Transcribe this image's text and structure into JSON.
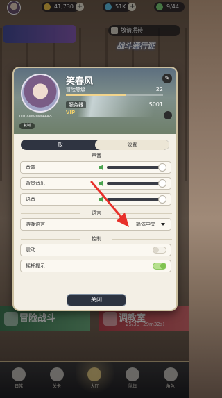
{
  "topbar": {
    "currency1": "41,730",
    "currency2": "51K",
    "stamina": "9/44",
    "colors": {
      "coin": "#f1c44a",
      "gem": "#62c3e8",
      "energy": "#7fd47a"
    }
  },
  "background": {
    "notice_label": "敬请期待",
    "battle_pass_label": "战斗通行证",
    "adventure_label": "冒险战斗",
    "training_label": "调教室",
    "training_sub": "25/30 (29m32s)",
    "nav": [
      {
        "label": "日常",
        "icon": "calendar-icon"
      },
      {
        "label": "关卡",
        "icon": "book-icon"
      },
      {
        "label": "大厅",
        "icon": "hall-icon",
        "active": true
      },
      {
        "label": "队伍",
        "icon": "team-icon"
      },
      {
        "label": "角色",
        "icon": "character-icon"
      }
    ]
  },
  "profile": {
    "name": "笑春风",
    "level_label": "冒险等级",
    "level": "22",
    "level_progress": 0.62,
    "server_label": "服务器",
    "server": "S001",
    "vip_label": "VIP",
    "uid": "UID 2308409499965",
    "copy_label": "复制"
  },
  "tabs": {
    "general": "一般",
    "settings": "设置"
  },
  "sections": {
    "sound": "声音",
    "language": "语言",
    "control": "控制"
  },
  "sound": {
    "sfx": {
      "label": "音效",
      "level": 1.0
    },
    "bgm": {
      "label": "背景音乐",
      "level": 1.0
    },
    "voice": {
      "label": "语音",
      "level": 1.0
    }
  },
  "language": {
    "label": "游戏语言",
    "value": "简体中文"
  },
  "control": {
    "vibration": {
      "label": "震动",
      "on": false
    },
    "joystick_hint": {
      "label": "摇杆提示",
      "on": true
    }
  },
  "close_label": "关闭",
  "accent_color": "#4aa34f",
  "annotation_color": "#e8302a"
}
